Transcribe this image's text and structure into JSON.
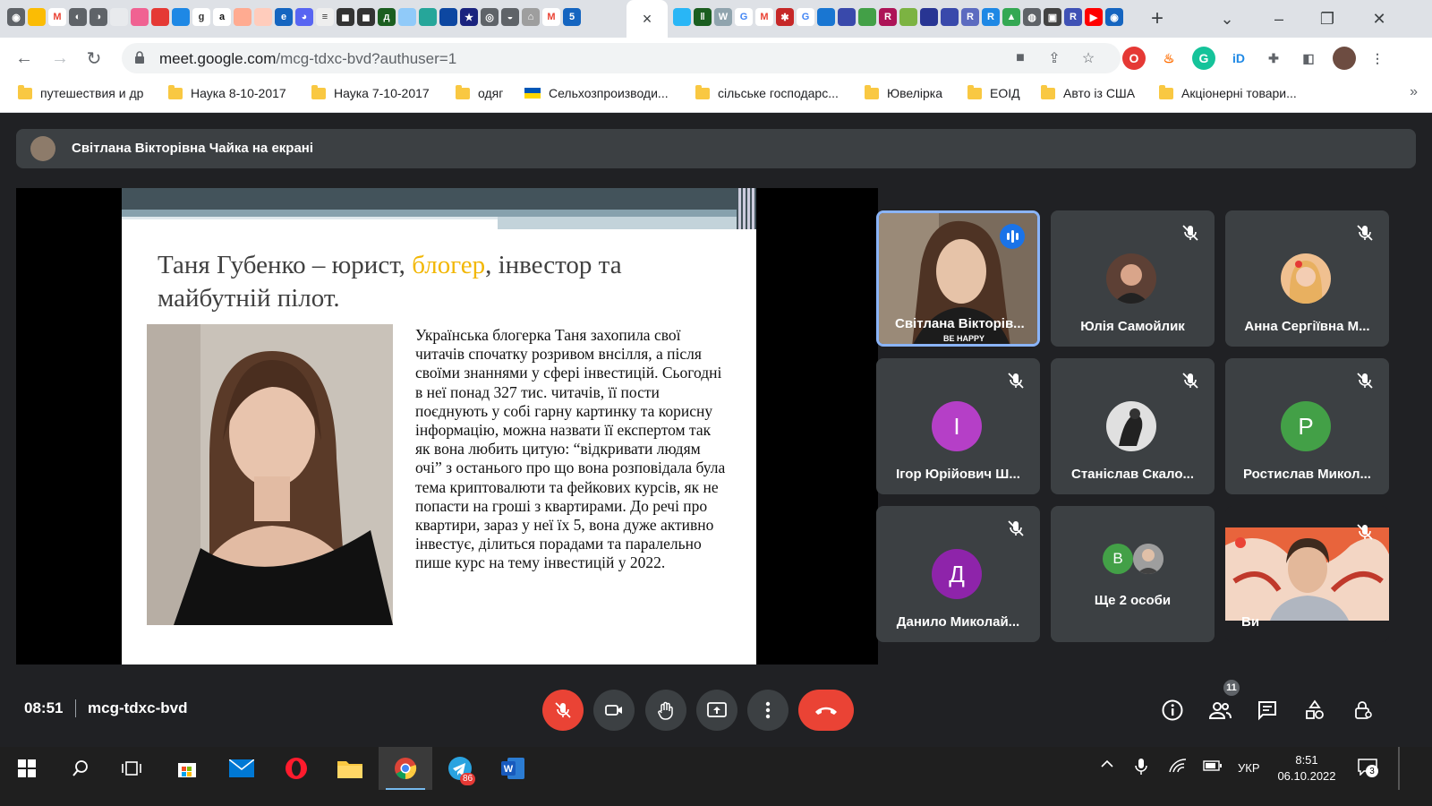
{
  "browser": {
    "url_host": "meet.google.com",
    "url_path": "/mcg-tdxc-bvd?authuser=1",
    "bookmarks": [
      {
        "label": "путешествия и др",
        "icon": "folder-icon"
      },
      {
        "label": "Наука 8-10-2017",
        "icon": "folder-icon"
      },
      {
        "label": "Наука 7-10-2017",
        "icon": "folder-icon"
      },
      {
        "label": "одяг",
        "icon": "folder-icon"
      },
      {
        "label": "Сельхозпроизводи...",
        "icon": "ukraine-flag-icon"
      },
      {
        "label": "сільське господарс...",
        "icon": "folder-icon"
      },
      {
        "label": "Ювелірка",
        "icon": "folder-icon"
      },
      {
        "label": "ЕОІД",
        "icon": "folder-icon"
      },
      {
        "label": "Авто із США",
        "icon": "folder-icon"
      },
      {
        "label": "Акціонерні товари...",
        "icon": "folder-icon"
      }
    ],
    "bookmarks_more": "»",
    "new_tab_label": "+",
    "close_tab_label": "×"
  },
  "meet": {
    "presenter_label": "Світлана Вікторівна Чайка на екрані",
    "slide": {
      "title_part1": "Таня Губенко – юрист, ",
      "title_highlight": "блогер",
      "title_part2": ", інвестор та майбутній пілот.",
      "body": "Українська блогерка Таня захопила свої читачів спочатку розривом внсілля, а після своїми знаннями у сфері інвестицій. Сьогодні в неї понад 327 тис. читачів, її пости поєднують у собі гарну картинку та корисну інформацію, можна назвати її експертом так як вона любить цитую: “відкривати людям очі” з останього про що вона розповідала була тема криптовалюти та фейкових курсів, як не попасти на гроші з квартирами. До речі про квартири, зараз у неї їх 5, вона дуже активно інвестує, ділиться порадами та паралельно пише курс на тему інвестицій у 2022."
    },
    "participants": [
      {
        "name": "Світлана Вікторів...",
        "speaking": true,
        "caption": "BE HAPPY"
      },
      {
        "name": "Юлія Самойлик"
      },
      {
        "name": "Анна Сергіївна М..."
      },
      {
        "name": "Ігор Юрійович Ш...",
        "initial": "І",
        "color": "#b53fc7"
      },
      {
        "name": "Станіслав Скало..."
      },
      {
        "name": "Ростислав Микол...",
        "initial": "Р",
        "color": "#43a047"
      },
      {
        "name": "Данило Миколай...",
        "initial": "Д",
        "color": "#8e24aa"
      },
      {
        "name": "Ще 2 особи",
        "initial": "В",
        "color": "#43a047"
      },
      {
        "name": "Ви"
      }
    ],
    "time": "08:51",
    "meeting_code": "mcg-tdxc-bvd",
    "people_count": "11"
  },
  "taskbar": {
    "telegram_badge": "86",
    "language": "УКР",
    "clock_time": "8:51",
    "clock_date": "06.10.2022",
    "notification_count": "3"
  },
  "colors": {
    "accent_blue": "#1a73e8",
    "meet_red": "#ea4335",
    "slide_highlight": "#f2b705",
    "meet_bg": "#202124"
  }
}
